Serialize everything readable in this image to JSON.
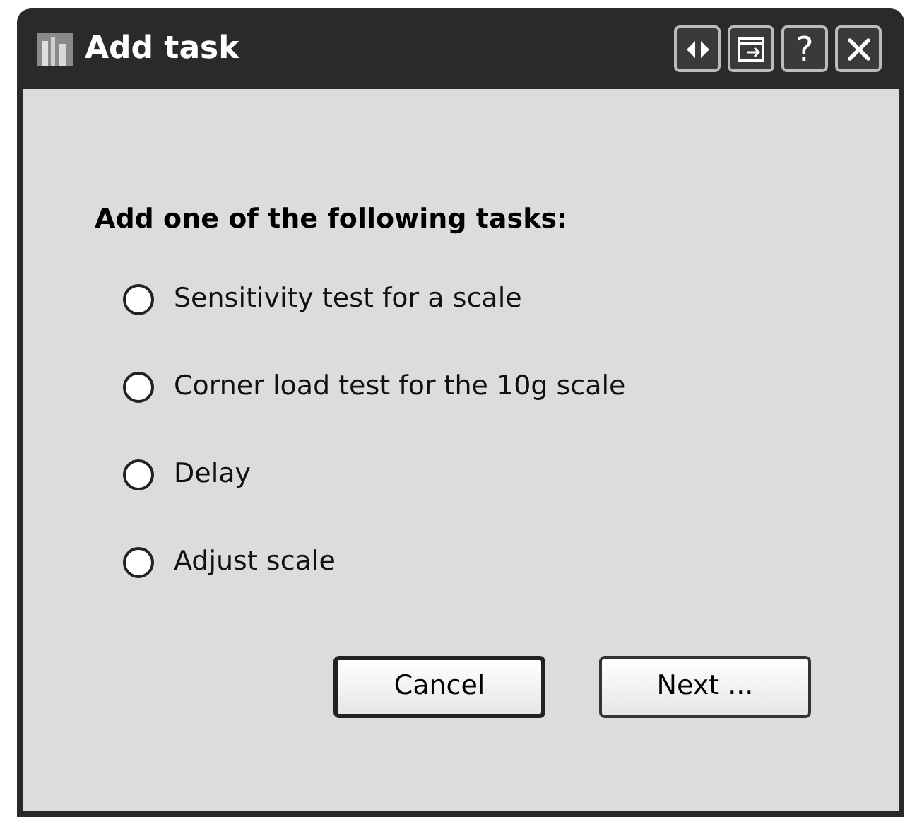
{
  "window": {
    "title": "Add task",
    "help_label": "?"
  },
  "heading": "Add one of the following tasks:",
  "options": [
    {
      "label": "Sensitivity test for a scale",
      "selected": false
    },
    {
      "label": "Corner load test for the 10g scale",
      "selected": false
    },
    {
      "label": "Delay",
      "selected": false
    },
    {
      "label": "Adjust scale",
      "selected": false
    }
  ],
  "buttons": [
    {
      "label": "Cancel",
      "default": true
    },
    {
      "label": "Next ...",
      "default": false
    }
  ]
}
